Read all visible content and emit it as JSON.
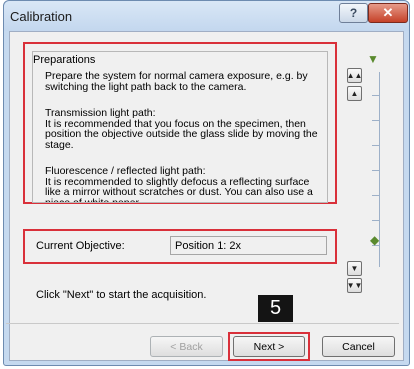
{
  "window": {
    "title": "Calibration",
    "help_icon_glyph": "?",
    "close_icon_glyph": "✕"
  },
  "preparations": {
    "group_label": "Preparations",
    "paragraphs": [
      "Prepare the system for normal camera exposure, e.g. by\nswitching the light path back to the camera.",
      "Transmission light path:\nIt is recommended that you focus on the specimen, then\nposition the objective outside the glass slide by moving the\nstage.",
      "Fluorescence / reflected light path:\nIt is recommended to slightly defocus a reflecting surface\nlike a mirror without scratches or dust. You can also use a\npiece of white paper"
    ]
  },
  "objective": {
    "label": "Current Objective:",
    "value": "Position 1: 2x"
  },
  "hint": "Click \"Next\" to start the acquisition.",
  "badge": "5",
  "buttons": {
    "back": "< Back",
    "next": "Next >",
    "cancel": "Cancel"
  },
  "focus_controls": {
    "icons": [
      "double-up-arrow-icon",
      "up-arrow-icon",
      "down-arrow-icon",
      "double-down-arrow-icon"
    ]
  }
}
